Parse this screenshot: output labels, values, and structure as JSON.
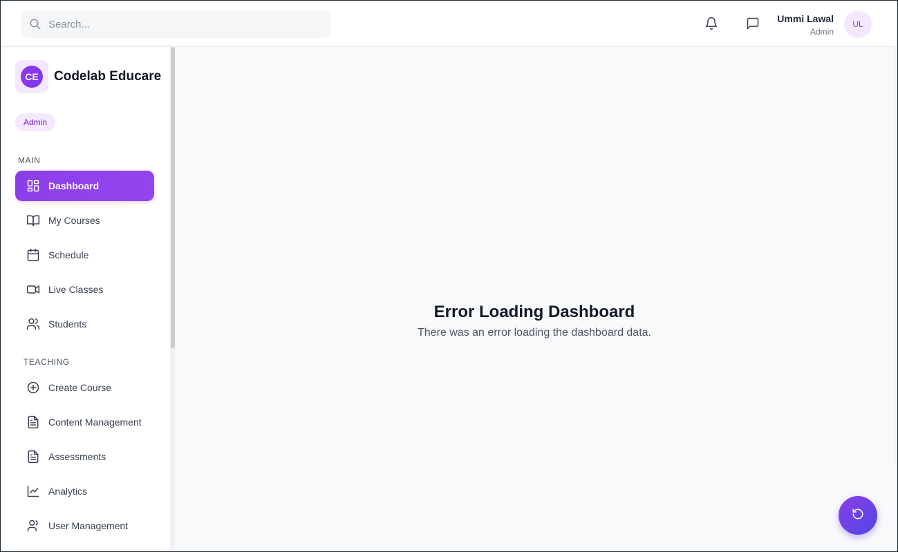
{
  "search": {
    "placeholder": "Search..."
  },
  "header": {
    "user_name": "Ummi Lawal",
    "user_role": "Admin",
    "avatar_initials": "UL"
  },
  "brand": {
    "logo_initials": "CE",
    "name": "Codelab Educare"
  },
  "sidebar": {
    "role_badge": "Admin",
    "sections": [
      {
        "label": "MAIN",
        "items": [
          {
            "label": "Dashboard",
            "icon": "dashboard-icon",
            "active": true
          },
          {
            "label": "My Courses",
            "icon": "book-icon"
          },
          {
            "label": "Schedule",
            "icon": "calendar-icon"
          },
          {
            "label": "Live Classes",
            "icon": "video-icon"
          },
          {
            "label": "Students",
            "icon": "users-icon"
          }
        ]
      },
      {
        "label": "TEACHING",
        "items": [
          {
            "label": "Create Course",
            "icon": "plus-circle-icon"
          },
          {
            "label": "Content Management",
            "icon": "file-text-icon"
          },
          {
            "label": "Assessments",
            "icon": "file-text-icon"
          },
          {
            "label": "Analytics",
            "icon": "line-chart-icon"
          },
          {
            "label": "User Management",
            "icon": "user-icon"
          }
        ]
      }
    ]
  },
  "main": {
    "error_title": "Error Loading Dashboard",
    "error_message": "There was an error loading the dashboard data."
  },
  "colors": {
    "accent": "#9333ea",
    "accent_light": "#f3e8ff",
    "fab_gradient_end": "#4f46e5"
  }
}
